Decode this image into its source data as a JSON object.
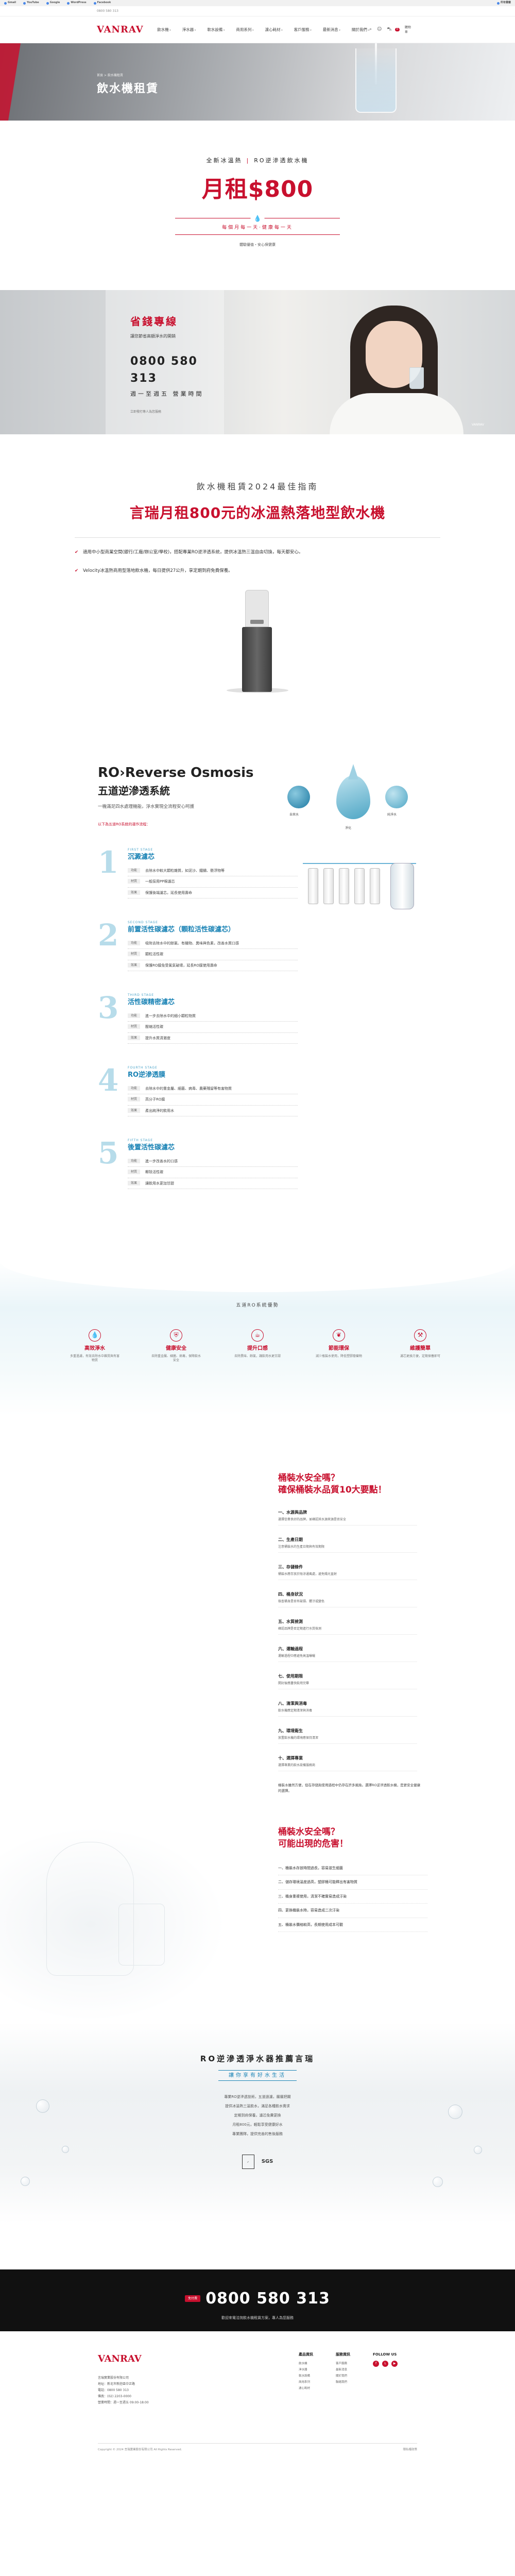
{
  "bookmarks": [
    "Gmail",
    "YouTube",
    "Google",
    "WordPress",
    "Facebook",
    "所有書籤"
  ],
  "topbar": {
    "text": "0800 580 313"
  },
  "header": {
    "logo": "VANRAV",
    "nav": [
      "飲水機",
      "淨水器",
      "軟水設備",
      "商用系列",
      "濾心耗材",
      "客戶服務",
      "最新消息",
      "關於我們"
    ],
    "cart_count": "0",
    "cart_label": "購物車"
  },
  "hero": {
    "breadcrumb": "首頁 > 飲水機租賃",
    "title": "飲水機租賃"
  },
  "promo": {
    "sub_left": "全新冰溫熱",
    "sub_right": "RO逆滲透飲水機",
    "price": "月租$800",
    "motto": "每個月每一天‧健康每一天",
    "note": "體驗優值・安心保健康"
  },
  "hotline": {
    "title": "省錢專線",
    "desc": "讓您節省高額淨水的開銷",
    "phone": "0800 580 313",
    "hours": "週一至週五 營業時間",
    "note": "立即撥打專人為您服務",
    "corner": "VANRAV"
  },
  "guide": {
    "label": "飲水機租賃2024最佳指南",
    "title": "言瑞月租800元的冰溫熱落地型飲水機",
    "items": [
      "適用中小型商業空間(銀行/工廠/辦公室/學校)，搭配專業RO逆滲透系統，提供冰溫熱三溫自由切換，每天都安心。",
      "Velocity冰溫熱商用型落地飲水機，每日提供27公升，享定期到府免費保養。"
    ]
  },
  "ro": {
    "title": "RO›Reverse Osmosis",
    "subtitle": "五道逆滲透系統",
    "desc": "一機滿足四水處理機能，淨水實現全流程安心呵護",
    "note": "以下為五道RO系統的運作流程：",
    "captions": [
      "自來水",
      "淨化",
      "純淨水"
    ],
    "stages": [
      {
        "num": "1",
        "label": "FIRST STAGE",
        "name": "沉澱濾芯",
        "rows": [
          {
            "tag": "功能",
            "text": "去除水中較大顆粒雜質，如泥沙、鐵鏽、懸浮物等"
          },
          {
            "tag": "材質",
            "text": "一般採用PP棉濾芯"
          },
          {
            "tag": "效果",
            "text": "保護後端濾芯，延長使用壽命"
          }
        ]
      },
      {
        "num": "2",
        "label": "SECOND STAGE",
        "name": "前置活性碳濾芯（顆粒活性碳濾芯）",
        "rows": [
          {
            "tag": "功能",
            "text": "吸附去除水中的餘氯、有機物、異味與色素，改善水質口感"
          },
          {
            "tag": "材質",
            "text": "顆粒活性碳"
          },
          {
            "tag": "效果",
            "text": "保護RO膜免受氯氣破壞，延長RO膜使用壽命"
          }
        ]
      },
      {
        "num": "3",
        "label": "THIRD STAGE",
        "name": "活性碳精密濾芯",
        "rows": [
          {
            "tag": "功能",
            "text": "進一步去除水中的細小顆粒物質"
          },
          {
            "tag": "材質",
            "text": "壓縮活性碳"
          },
          {
            "tag": "效果",
            "text": "提升水質清澈度"
          }
        ]
      },
      {
        "num": "4",
        "label": "FOURTH STAGE",
        "name": "RO逆滲透膜",
        "rows": [
          {
            "tag": "功能",
            "text": "去除水中的重金屬、細菌、病毒、農藥殘留等有害物質"
          },
          {
            "tag": "材質",
            "text": "高分子RO膜"
          },
          {
            "tag": "效果",
            "text": "產出純淨的飲用水"
          }
        ]
      },
      {
        "num": "5",
        "label": "FIFTH STAGE",
        "name": "後置活性碳濾芯",
        "rows": [
          {
            "tag": "功能",
            "text": "進一步改善水的口感"
          },
          {
            "tag": "材質",
            "text": "椰殼活性碳"
          },
          {
            "tag": "效果",
            "text": "讓飲用水更加甘甜"
          }
        ]
      }
    ]
  },
  "benefits": {
    "title": "五道RO系統優勢",
    "items": [
      {
        "icon": "drop",
        "name": "高效淨水",
        "desc": "多重過濾，有效去除水中雜質與有害物質"
      },
      {
        "icon": "shield",
        "name": "健康安全",
        "desc": "去除重金屬、細菌、病毒，保障飲水安全"
      },
      {
        "icon": "cup",
        "name": "提升口感",
        "desc": "去除異味、餘氯，讓飲用水更甘甜"
      },
      {
        "icon": "leaf",
        "name": "節能環保",
        "desc": "減少瓶裝水使用，降低塑膠廢棄物"
      },
      {
        "icon": "wrench",
        "name": "維護簡單",
        "desc": "濾芯更換方便，定期保養即可"
      }
    ]
  },
  "safety": {
    "question": "桶裝水安全嗎？\n確保桶裝水品質10大要點！",
    "items": [
      {
        "title": "一、水源與品牌",
        "desc": "選擇信譽良好的品牌，並確認其水源來源是否安全"
      },
      {
        "title": "二、生產日期",
        "desc": "注意桶裝水的生產日期與有效期限"
      },
      {
        "title": "三、存儲條件",
        "desc": "桶裝水應存放於陰涼通風處，避免陽光直射"
      },
      {
        "title": "四、桶身狀況",
        "desc": "檢查桶身是否有破損、髒汙或變色"
      },
      {
        "title": "五、水質檢測",
        "desc": "確認品牌是否定期進行水質檢測"
      },
      {
        "title": "六、運輸過程",
        "desc": "運輸過程中應避免高溫曝曬"
      },
      {
        "title": "七、使用期限",
        "desc": "開封後應盡快飲用完畢"
      },
      {
        "title": "八、清潔與消毒",
        "desc": "飲水機應定期清潔與消毒"
      },
      {
        "title": "九、環境衛生",
        "desc": "放置飲水機的環境應保持清潔"
      },
      {
        "title": "十、選擇專業",
        "desc": "選擇專業的飲水設備服務商"
      }
    ],
    "summary": "桶裝水雖然方便，但在存儲與使用過程中仍存在許多風險。選擇RO逆滲透飲水機，是更安全健康的選擇。"
  },
  "danger": {
    "question": "桶裝水安全嗎？\n可能出現的危害！",
    "items": [
      "一、桶裝水存放時間過長，容易滋生細菌",
      "二、儲存環境溫度過高，塑膠桶可能釋出有害物質",
      "三、桶身重複使用，清潔不確實易造成汙染",
      "四、更換桶裝水時，容易造成二次汙染",
      "五、桶裝水價格較高，長期使用成本可觀"
    ]
  },
  "recommend": {
    "title": "RO逆滲透淨水器推薦言瑞",
    "tag": "讓你享有好水生活",
    "lines": [
      "專業RO逆滲透技術，五道過濾，層層把關",
      "提供冰溫熱三溫飲水，滿足各種飲水需求",
      "定期到府保養，濾芯免費更換",
      "月租800元，輕鬆享受健康好水",
      "專業團隊，提供完善的售後服務"
    ],
    "cert": "SGS"
  },
  "cta": {
    "badge": "免付費",
    "phone": "0800 580 313",
    "desc": "歡迎來電洽詢飲水機租賃方案，專人為您服務"
  },
  "footer": {
    "logo": "VANRAV",
    "info": [
      "言瑞實業股份有限公司",
      "地址：新北市新莊區中正路",
      "電話：0800 580 313",
      "傳真：(02) 2203-0000",
      "營業時間：週一至週五 09:00-18:00"
    ],
    "cols": [
      {
        "title": "產品資訊",
        "items": [
          "飲水機",
          "淨水器",
          "軟水設備",
          "商用系列",
          "濾心耗材"
        ]
      },
      {
        "title": "服務資訊",
        "items": [
          "客戶服務",
          "最新消息",
          "關於我們",
          "聯絡我們"
        ]
      },
      {
        "title": "FOLLOW US",
        "items": []
      }
    ],
    "copyright_left": "Copyright © 2024 言瑞實業股份有限公司 All Rights Reserved.",
    "copyright_right": "隱私權政策"
  }
}
